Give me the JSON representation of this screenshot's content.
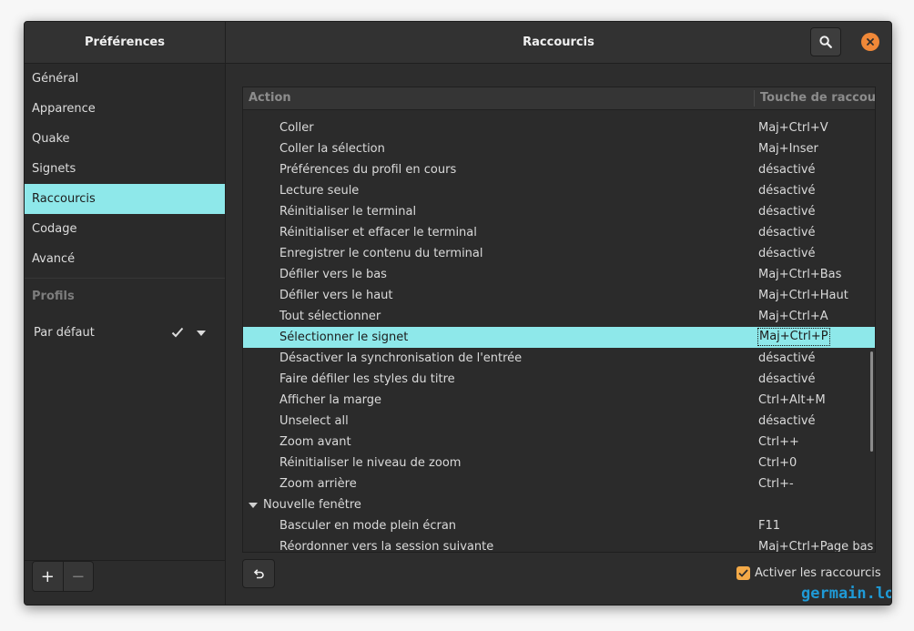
{
  "window": {
    "sidebar_title": "Préférences",
    "content_title": "Raccourcis"
  },
  "sidebar": {
    "items": [
      {
        "label": "Général"
      },
      {
        "label": "Apparence"
      },
      {
        "label": "Quake"
      },
      {
        "label": "Signets"
      },
      {
        "label": "Raccourcis",
        "active": true
      },
      {
        "label": "Codage"
      },
      {
        "label": "Avancé"
      }
    ],
    "profiles_heading": "Profils",
    "profile_default": "Par défaut",
    "add_label": "+",
    "remove_label": "−"
  },
  "table": {
    "col_action": "Action",
    "col_shortcut": "Touche de raccourci",
    "rows": [
      {
        "action": "Coller",
        "shortcut": "Maj+Ctrl+V"
      },
      {
        "action": "Coller la sélection",
        "shortcut": "Maj+Inser"
      },
      {
        "action": "Préférences du profil en cours",
        "shortcut": "désactivé"
      },
      {
        "action": "Lecture seule",
        "shortcut": "désactivé"
      },
      {
        "action": "Réinitialiser le terminal",
        "shortcut": "désactivé"
      },
      {
        "action": "Réinitialiser et effacer le terminal",
        "shortcut": "désactivé"
      },
      {
        "action": "Enregistrer le contenu du terminal",
        "shortcut": "désactivé"
      },
      {
        "action": "Défiler vers le bas",
        "shortcut": "Maj+Ctrl+Bas"
      },
      {
        "action": "Défiler vers le haut",
        "shortcut": "Maj+Ctrl+Haut"
      },
      {
        "action": "Tout sélectionner",
        "shortcut": "Maj+Ctrl+A"
      },
      {
        "action": "Sélectionner le signet",
        "shortcut": "Maj+Ctrl+P",
        "selected": true
      },
      {
        "action": "Désactiver la synchronisation de l'entrée",
        "shortcut": "désactivé"
      },
      {
        "action": "Faire défiler les styles du titre",
        "shortcut": "désactivé"
      },
      {
        "action": "Afficher la marge",
        "shortcut": "Ctrl+Alt+M"
      },
      {
        "action": "Unselect all",
        "shortcut": "désactivé"
      },
      {
        "action": "Zoom avant",
        "shortcut": "Ctrl++"
      },
      {
        "action": "Réinitialiser le niveau de zoom",
        "shortcut": "Ctrl+0"
      },
      {
        "action": "Zoom arrière",
        "shortcut": "Ctrl+-"
      },
      {
        "action": "Nouvelle fenêtre",
        "shortcut": "",
        "group": true
      },
      {
        "action": "Basculer en mode plein écran",
        "shortcut": "F11"
      },
      {
        "action": "Réordonner vers la session suivante",
        "shortcut": "Maj+Ctrl+Page bas"
      }
    ]
  },
  "footer": {
    "enable_label": "Activer les raccourcis",
    "enable_checked": true
  },
  "watermark": "germain.lol",
  "colors": {
    "accent": "#8ee8ea",
    "close": "#f08838",
    "checkbox": "#f3a947",
    "watermark": "#1f9ad6"
  }
}
